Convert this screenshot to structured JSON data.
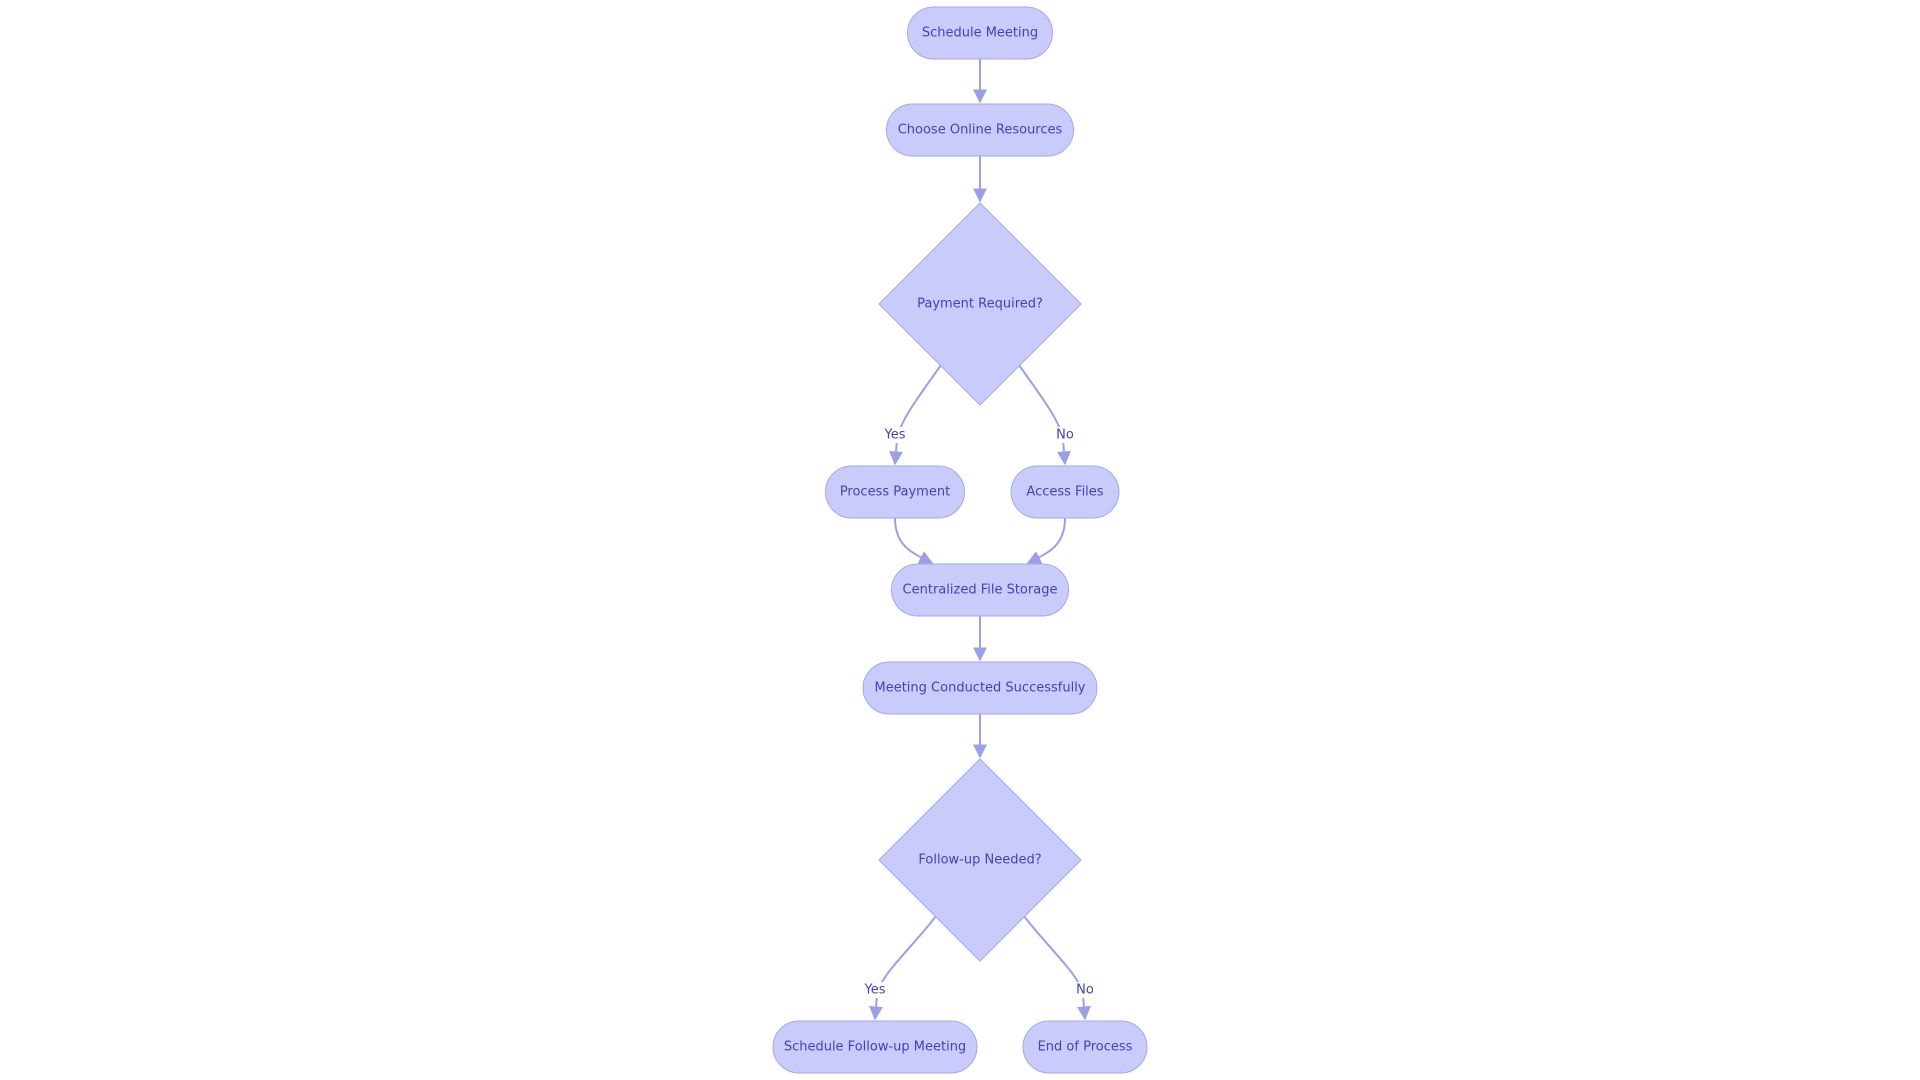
{
  "diagram": {
    "type": "flowchart",
    "colors": {
      "node_fill": "#c9ccfb",
      "node_stroke": "#a3a7ee",
      "edge": "#9ba0e6",
      "text": "#3f43b8"
    },
    "nodes": [
      {
        "id": "schedule",
        "label": "Schedule Meeting",
        "shape": "rounded"
      },
      {
        "id": "choose",
        "label": "Choose Online Resources",
        "shape": "rounded"
      },
      {
        "id": "payment_q",
        "label": "Payment Required?",
        "shape": "diamond"
      },
      {
        "id": "process_payment",
        "label": "Process Payment",
        "shape": "rounded"
      },
      {
        "id": "access_files",
        "label": "Access Files",
        "shape": "rounded"
      },
      {
        "id": "storage",
        "label": "Centralized File Storage",
        "shape": "rounded"
      },
      {
        "id": "conducted",
        "label": "Meeting Conducted Successfully",
        "shape": "rounded"
      },
      {
        "id": "followup_q",
        "label": "Follow-up Needed?",
        "shape": "diamond"
      },
      {
        "id": "schedule_followup",
        "label": "Schedule Follow-up Meeting",
        "shape": "rounded"
      },
      {
        "id": "end",
        "label": "End of Process",
        "shape": "rounded"
      }
    ],
    "edges": [
      {
        "from": "schedule",
        "to": "choose",
        "label": ""
      },
      {
        "from": "choose",
        "to": "payment_q",
        "label": ""
      },
      {
        "from": "payment_q",
        "to": "process_payment",
        "label": "Yes"
      },
      {
        "from": "payment_q",
        "to": "access_files",
        "label": "No"
      },
      {
        "from": "process_payment",
        "to": "storage",
        "label": ""
      },
      {
        "from": "access_files",
        "to": "storage",
        "label": ""
      },
      {
        "from": "storage",
        "to": "conducted",
        "label": ""
      },
      {
        "from": "conducted",
        "to": "followup_q",
        "label": ""
      },
      {
        "from": "followup_q",
        "to": "schedule_followup",
        "label": "Yes"
      },
      {
        "from": "followup_q",
        "to": "end",
        "label": "No"
      }
    ]
  }
}
